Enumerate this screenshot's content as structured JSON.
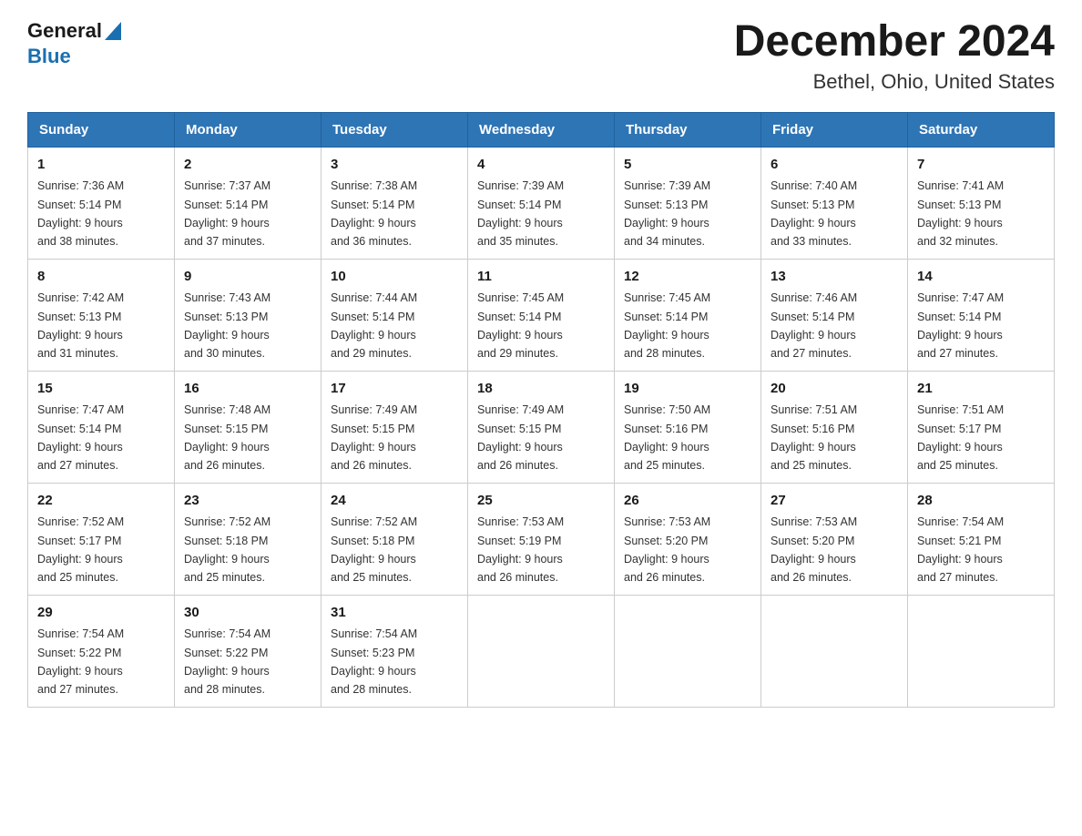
{
  "header": {
    "logo_general": "General",
    "logo_blue": "Blue",
    "month_title": "December 2024",
    "location": "Bethel, Ohio, United States"
  },
  "days_of_week": [
    "Sunday",
    "Monday",
    "Tuesday",
    "Wednesday",
    "Thursday",
    "Friday",
    "Saturday"
  ],
  "weeks": [
    [
      {
        "day": "1",
        "sunrise": "7:36 AM",
        "sunset": "5:14 PM",
        "daylight": "9 hours and 38 minutes."
      },
      {
        "day": "2",
        "sunrise": "7:37 AM",
        "sunset": "5:14 PM",
        "daylight": "9 hours and 37 minutes."
      },
      {
        "day": "3",
        "sunrise": "7:38 AM",
        "sunset": "5:14 PM",
        "daylight": "9 hours and 36 minutes."
      },
      {
        "day": "4",
        "sunrise": "7:39 AM",
        "sunset": "5:14 PM",
        "daylight": "9 hours and 35 minutes."
      },
      {
        "day": "5",
        "sunrise": "7:39 AM",
        "sunset": "5:13 PM",
        "daylight": "9 hours and 34 minutes."
      },
      {
        "day": "6",
        "sunrise": "7:40 AM",
        "sunset": "5:13 PM",
        "daylight": "9 hours and 33 minutes."
      },
      {
        "day": "7",
        "sunrise": "7:41 AM",
        "sunset": "5:13 PM",
        "daylight": "9 hours and 32 minutes."
      }
    ],
    [
      {
        "day": "8",
        "sunrise": "7:42 AM",
        "sunset": "5:13 PM",
        "daylight": "9 hours and 31 minutes."
      },
      {
        "day": "9",
        "sunrise": "7:43 AM",
        "sunset": "5:13 PM",
        "daylight": "9 hours and 30 minutes."
      },
      {
        "day": "10",
        "sunrise": "7:44 AM",
        "sunset": "5:14 PM",
        "daylight": "9 hours and 29 minutes."
      },
      {
        "day": "11",
        "sunrise": "7:45 AM",
        "sunset": "5:14 PM",
        "daylight": "9 hours and 29 minutes."
      },
      {
        "day": "12",
        "sunrise": "7:45 AM",
        "sunset": "5:14 PM",
        "daylight": "9 hours and 28 minutes."
      },
      {
        "day": "13",
        "sunrise": "7:46 AM",
        "sunset": "5:14 PM",
        "daylight": "9 hours and 27 minutes."
      },
      {
        "day": "14",
        "sunrise": "7:47 AM",
        "sunset": "5:14 PM",
        "daylight": "9 hours and 27 minutes."
      }
    ],
    [
      {
        "day": "15",
        "sunrise": "7:47 AM",
        "sunset": "5:14 PM",
        "daylight": "9 hours and 27 minutes."
      },
      {
        "day": "16",
        "sunrise": "7:48 AM",
        "sunset": "5:15 PM",
        "daylight": "9 hours and 26 minutes."
      },
      {
        "day": "17",
        "sunrise": "7:49 AM",
        "sunset": "5:15 PM",
        "daylight": "9 hours and 26 minutes."
      },
      {
        "day": "18",
        "sunrise": "7:49 AM",
        "sunset": "5:15 PM",
        "daylight": "9 hours and 26 minutes."
      },
      {
        "day": "19",
        "sunrise": "7:50 AM",
        "sunset": "5:16 PM",
        "daylight": "9 hours and 25 minutes."
      },
      {
        "day": "20",
        "sunrise": "7:51 AM",
        "sunset": "5:16 PM",
        "daylight": "9 hours and 25 minutes."
      },
      {
        "day": "21",
        "sunrise": "7:51 AM",
        "sunset": "5:17 PM",
        "daylight": "9 hours and 25 minutes."
      }
    ],
    [
      {
        "day": "22",
        "sunrise": "7:52 AM",
        "sunset": "5:17 PM",
        "daylight": "9 hours and 25 minutes."
      },
      {
        "day": "23",
        "sunrise": "7:52 AM",
        "sunset": "5:18 PM",
        "daylight": "9 hours and 25 minutes."
      },
      {
        "day": "24",
        "sunrise": "7:52 AM",
        "sunset": "5:18 PM",
        "daylight": "9 hours and 25 minutes."
      },
      {
        "day": "25",
        "sunrise": "7:53 AM",
        "sunset": "5:19 PM",
        "daylight": "9 hours and 26 minutes."
      },
      {
        "day": "26",
        "sunrise": "7:53 AM",
        "sunset": "5:20 PM",
        "daylight": "9 hours and 26 minutes."
      },
      {
        "day": "27",
        "sunrise": "7:53 AM",
        "sunset": "5:20 PM",
        "daylight": "9 hours and 26 minutes."
      },
      {
        "day": "28",
        "sunrise": "7:54 AM",
        "sunset": "5:21 PM",
        "daylight": "9 hours and 27 minutes."
      }
    ],
    [
      {
        "day": "29",
        "sunrise": "7:54 AM",
        "sunset": "5:22 PM",
        "daylight": "9 hours and 27 minutes."
      },
      {
        "day": "30",
        "sunrise": "7:54 AM",
        "sunset": "5:22 PM",
        "daylight": "9 hours and 28 minutes."
      },
      {
        "day": "31",
        "sunrise": "7:54 AM",
        "sunset": "5:23 PM",
        "daylight": "9 hours and 28 minutes."
      },
      null,
      null,
      null,
      null
    ]
  ]
}
